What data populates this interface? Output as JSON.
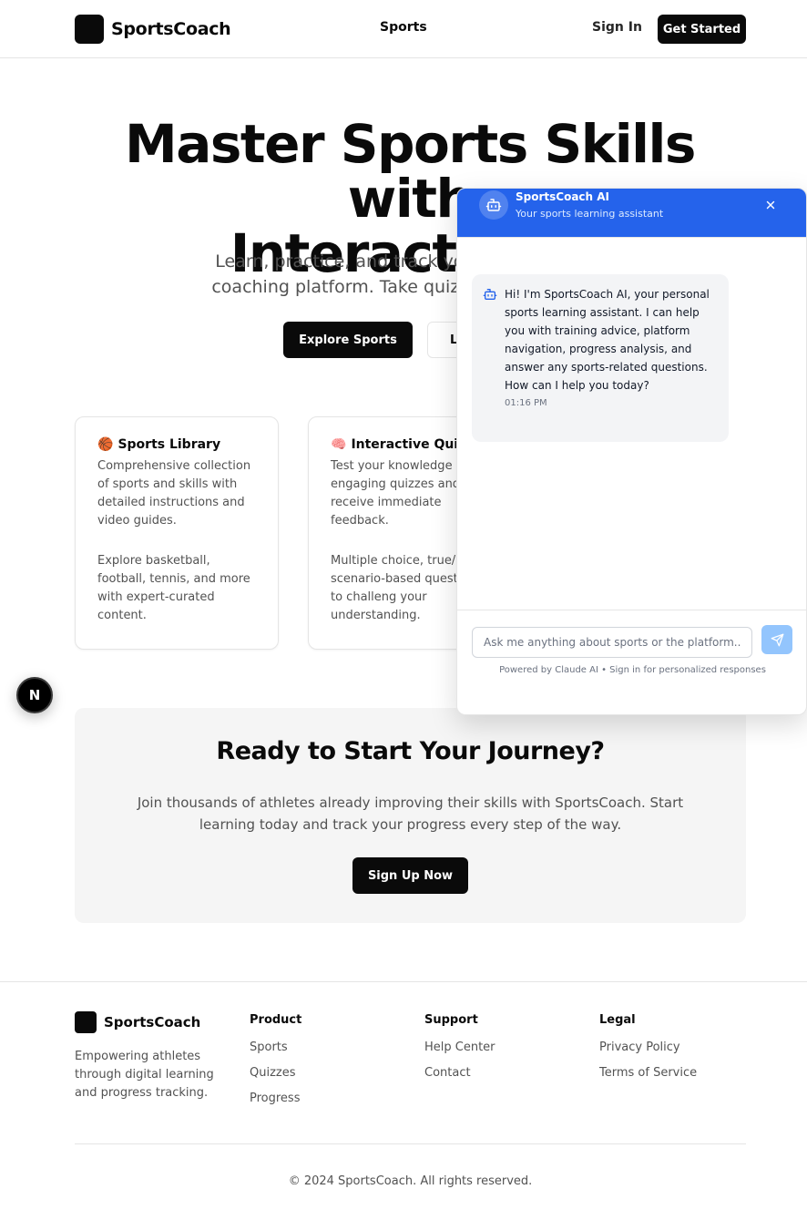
{
  "header": {
    "brand": "SportsCoach",
    "nav_sports": "Sports",
    "sign_in": "Sign In",
    "get_started": "Get Started"
  },
  "hero": {
    "title_line1": "Master Sports Skills with",
    "title_line2": "Interactive L",
    "subtitle_line1": "Learn, practice, and track your progress with",
    "subtitle_line2": "coaching platform. Take quizzes, master skills",
    "explore_button": "Explore Sports",
    "learn_button": "Learn More"
  },
  "cards": [
    {
      "emoji": "🏀",
      "title": "Sports Library",
      "description": "Comprehensive collection of sports and skills with detailed instructions and video guides.",
      "more": "Explore basketball, football, tennis, and more with expert-curated content."
    },
    {
      "emoji": "🧠",
      "title": "Interactive Quiz",
      "description": "Test your knowledge w engaging quizzes and receive immediate feedback.",
      "more": "Multiple choice, true/ and scenario-based questions to challeng your understanding."
    }
  ],
  "next_badge": "N",
  "cta": {
    "title": "Ready to Start Your Journey?",
    "text": "Join thousands of athletes already improving their skills with SportsCoach. Start learning today and track your progress every step of the way.",
    "button": "Sign Up Now"
  },
  "footer": {
    "brand": "SportsCoach",
    "tagline": "Empowering athletes through digital learning and progress tracking.",
    "columns": [
      {
        "title": "Product",
        "links": [
          "Sports",
          "Quizzes",
          "Progress"
        ]
      },
      {
        "title": "Support",
        "links": [
          "Help Center",
          "Contact"
        ]
      },
      {
        "title": "Legal",
        "links": [
          "Privacy Policy",
          "Terms of Service"
        ]
      }
    ],
    "copyright": "© 2024 SportsCoach. All rights reserved."
  },
  "chat": {
    "title": "SportsCoach AI",
    "subtitle": "Your sports learning assistant",
    "message": "Hi! I'm SportsCoach AI, your personal sports learning assistant. I can help you with training advice, platform navigation, progress analysis, and answer any sports-related questions. How can I help you today?",
    "time": "01:16 PM",
    "placeholder": "Ask me anything about sports or the platform...",
    "powered": "Powered by Claude AI • Sign in for personalized responses",
    "accent": "#2563eb"
  }
}
